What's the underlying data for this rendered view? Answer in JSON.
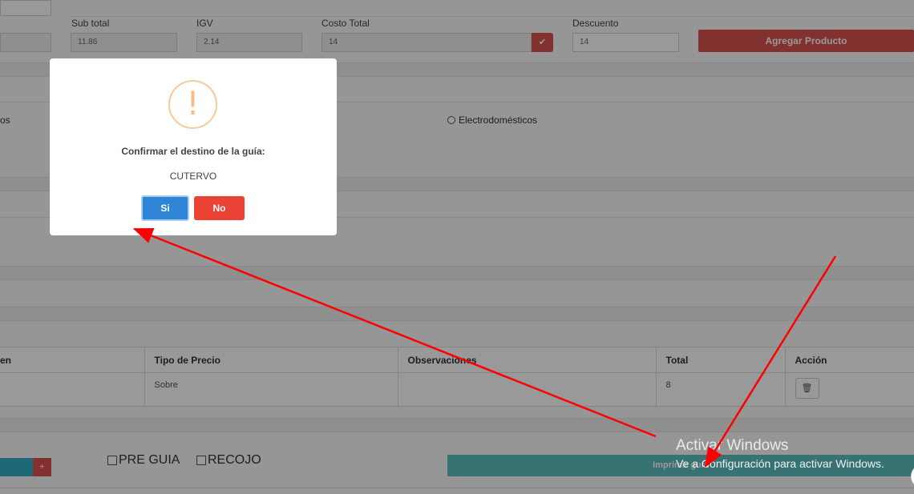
{
  "form": {
    "subtotal_label": "Sub total",
    "subtotal_value": "11.86",
    "igv_label": "IGV",
    "igv_value": "2.14",
    "costo_total_label": "Costo Total",
    "costo_total_value": "14",
    "descuento_label": "Descuento",
    "descuento_value": "14",
    "agregar_button": "Agregar Producto",
    "check_icon": "✔"
  },
  "categories": {
    "left_partial": "os",
    "electro": "Electrodomésticos"
  },
  "table": {
    "headers": [
      "en",
      "Tipo de Precio",
      "Observaciones",
      "Total",
      "Acción"
    ],
    "row": {
      "tipo_precio": "Sobre",
      "observaciones": "",
      "total": "8"
    },
    "trash_icon": "🗑"
  },
  "footer": {
    "plus_label": "+",
    "pre_guia": "PRE GUIA",
    "recojo": "RECOJO",
    "imprimir_button": "Imprimir guía"
  },
  "watermark": {
    "title": "Activar Windows",
    "subtitle": "Ve a Configuración para activar Windows."
  },
  "modal": {
    "icon": "!",
    "title": "Confirmar el destino de la guía:",
    "destination": "CUTERVO",
    "yes_label": "Si",
    "no_label": "No"
  },
  "colors": {
    "annotation_arrow": "#ff0000",
    "confirm_button": "#3085d6",
    "cancel_button": "#ea4335"
  }
}
